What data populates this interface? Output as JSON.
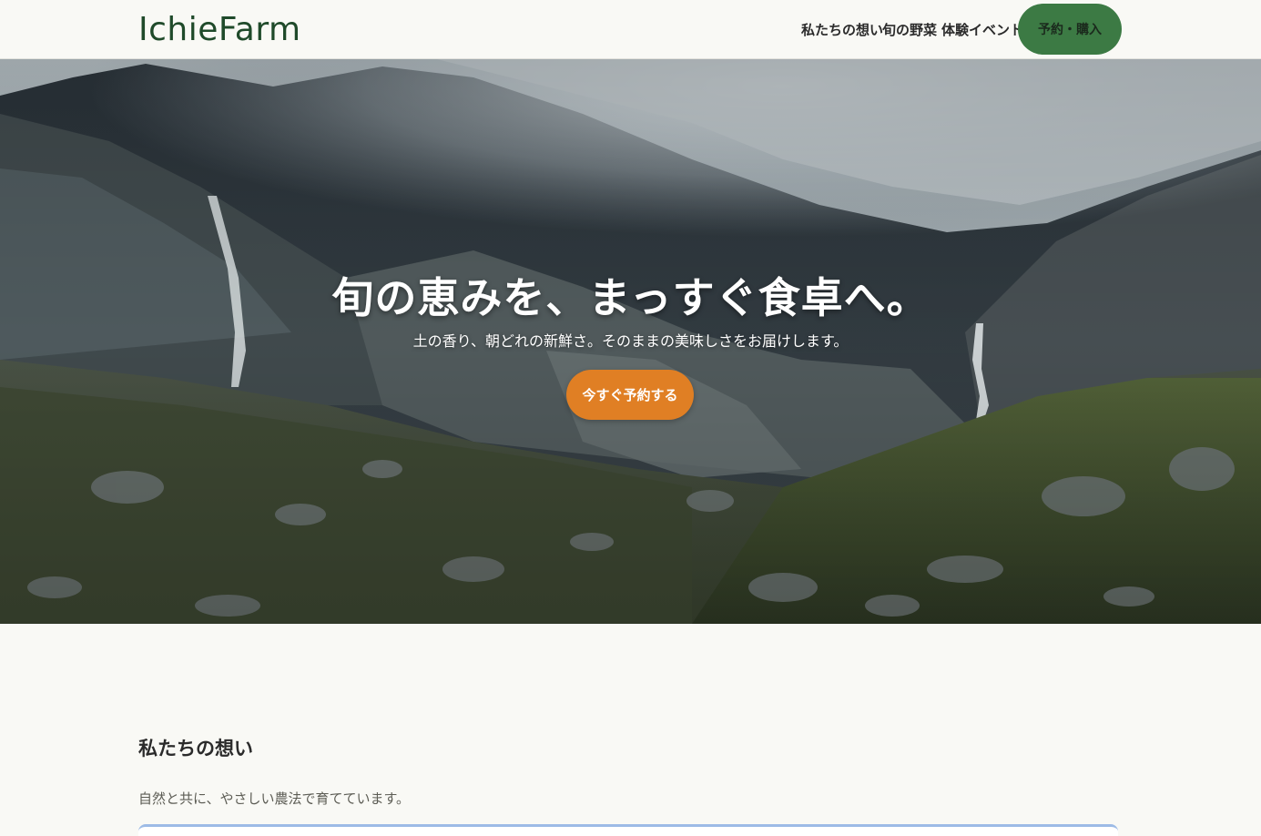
{
  "header": {
    "logo": "IchieFarm",
    "nav": [
      {
        "label": "私たちの想い"
      },
      {
        "label": "旬の野菜"
      },
      {
        "label": "体験イベント"
      }
    ],
    "cta_label": "予約・購入"
  },
  "hero": {
    "title": "旬の恵みを、まっすぐ食卓へ。",
    "subtitle": "土の香り、朝どれの新鮮さ。そのままの美味しさをお届けします。",
    "button_label": "今すぐ予約する",
    "image": "mountain-valley-waterfall-photo"
  },
  "about": {
    "title": "私たちの想い",
    "text": "自然と共に、やさしい農法で育てています。"
  },
  "colors": {
    "brand_green": "#1f4a2a",
    "cta_green": "#3c7a44",
    "accent_orange": "#e07f24",
    "page_bg": "#f9f9f5"
  }
}
